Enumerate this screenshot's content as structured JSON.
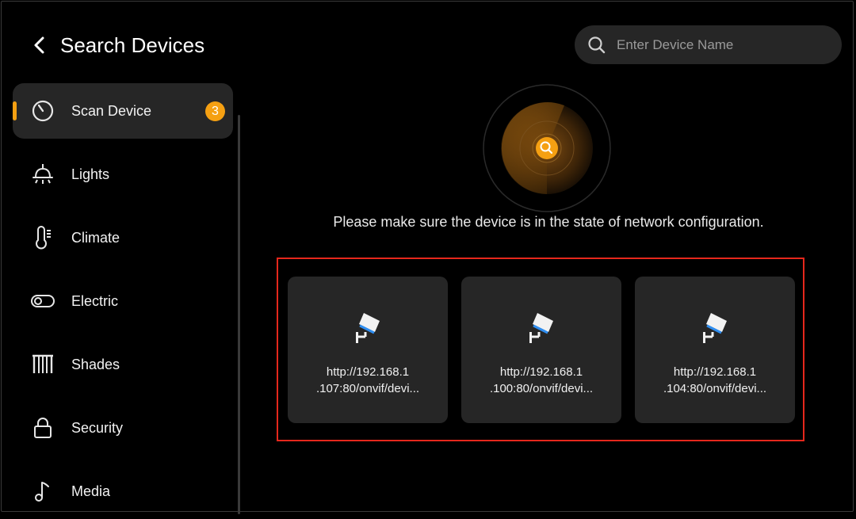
{
  "header": {
    "title": "Search Devices",
    "search_placeholder": "Enter Device Name"
  },
  "sidebar": {
    "items": [
      {
        "label": "Scan Device",
        "icon": "scan-icon",
        "badge": "3",
        "active": true
      },
      {
        "label": "Lights",
        "icon": "light-icon"
      },
      {
        "label": "Climate",
        "icon": "thermometer-icon"
      },
      {
        "label": "Electric",
        "icon": "switch-icon"
      },
      {
        "label": "Shades",
        "icon": "shades-icon"
      },
      {
        "label": "Security",
        "icon": "lock-icon"
      },
      {
        "label": "Media",
        "icon": "music-note-icon"
      }
    ]
  },
  "main": {
    "hint": "Please make sure the device is in the state of network configuration.",
    "devices": [
      {
        "url_line1": "http://192.168.1",
        "url_line2": ".107:80/onvif/devi...",
        "icon": "camera-icon"
      },
      {
        "url_line1": "http://192.168.1",
        "url_line2": ".100:80/onvif/devi...",
        "icon": "camera-icon"
      },
      {
        "url_line1": "http://192.168.1",
        "url_line2": ".104:80/onvif/devi...",
        "icon": "camera-icon"
      }
    ]
  },
  "colors": {
    "accent": "#f5a012",
    "highlight_border": "#e5271c",
    "camera_stripe": "#2f8ef0"
  }
}
